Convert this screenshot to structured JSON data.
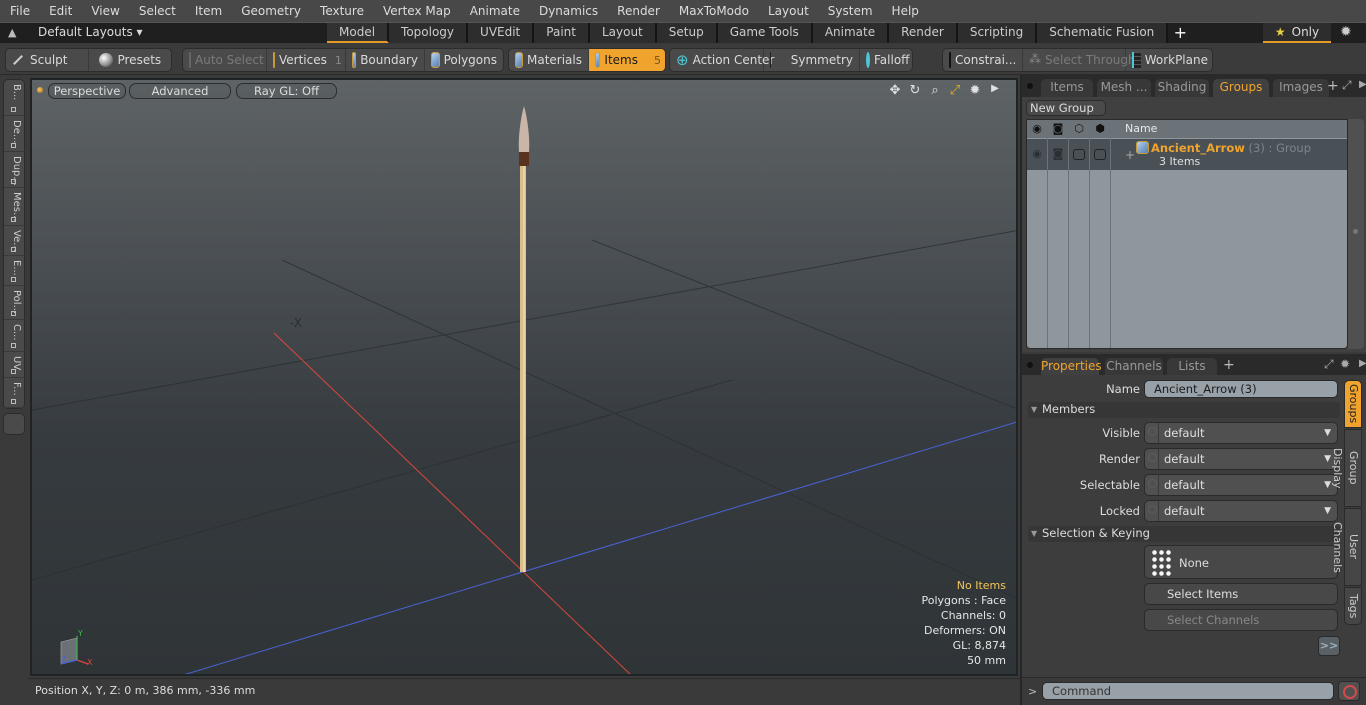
{
  "menubar": [
    "File",
    "Edit",
    "View",
    "Select",
    "Item",
    "Geometry",
    "Texture",
    "Vertex Map",
    "Animate",
    "Dynamics",
    "Render",
    "MaxToModo",
    "Layout",
    "System",
    "Help"
  ],
  "layoutbar": {
    "layouts_dropdown": "Default Layouts ▾",
    "tabs": [
      "Model",
      "Topology",
      "UVEdit",
      "Paint",
      "Layout",
      "Setup",
      "Game Tools",
      "Animate",
      "Render",
      "Scripting",
      "Schematic Fusion"
    ],
    "active_tab": "Model",
    "add_tab": "+",
    "only_label": "Only"
  },
  "toolbar": {
    "sculpt": "Sculpt",
    "presets": "Presets",
    "auto_select": "Auto Select",
    "vertices": "Vertices",
    "vertices_count": "1",
    "boundary": "Boundary",
    "polygons": "Polygons",
    "materials": "Materials",
    "items": "Items",
    "items_count": "5",
    "action_center": "Action Center",
    "symmetry": "Symmetry",
    "falloff": "Falloff",
    "constraints": "Constrai...",
    "select_through": "Select Through",
    "workplane": "WorkPlane"
  },
  "left_tabs": [
    "B...",
    "De...",
    "Dup...",
    "Mes...",
    "Ve...",
    "E...",
    "Pol...",
    "C...",
    "UV",
    "F..."
  ],
  "viewport": {
    "view_mode": "Perspective",
    "shading": "Advanced",
    "raygl": "Ray GL: Off",
    "stats": {
      "selection": "No Items",
      "polygons": "Polygons : Face",
      "channels": "Channels: 0",
      "deformers": "Deformers: ON",
      "gl": "GL: 8,874",
      "grid": "50 mm"
    },
    "axis_labels": {
      "x": "X",
      "y": "Y",
      "z": "Z"
    },
    "colors": {
      "x_axis": "#d9483a",
      "z_axis": "#4a63d8",
      "y_axis": "#3fb84a",
      "accent": "#f0a42d"
    }
  },
  "statusbar": {
    "position": "Position X, Y, Z:   0 m, 386 mm, -336 mm"
  },
  "groups_panel": {
    "tabs": [
      "Items",
      "Mesh ...",
      "Shading",
      "Groups",
      "Images"
    ],
    "active_tab": "Groups",
    "new_group": "New Group",
    "column_name": "Name",
    "rows": [
      {
        "name": "Ancient_Arrow",
        "count": "(3)",
        "type": ": Group",
        "sub": "3 Items"
      }
    ]
  },
  "properties_panel": {
    "tabs": [
      "Properties",
      "Channels",
      "Lists"
    ],
    "active_tab": "Properties",
    "name_label": "Name",
    "name_value": "Ancient_Arrow (3)",
    "members_section": "Members",
    "fields": [
      {
        "label": "Visible",
        "value": "default"
      },
      {
        "label": "Render",
        "value": "default"
      },
      {
        "label": "Selectable",
        "value": "default"
      },
      {
        "label": "Locked",
        "value": "default"
      }
    ],
    "selection_section": "Selection & Keying",
    "keying_value": "None",
    "select_items": "Select Items",
    "select_channels": "Select Channels",
    "more": ">>",
    "side_tabs": [
      "Groups",
      "Group Display",
      "User Channels",
      "Tags"
    ]
  },
  "command": {
    "prompt": ">",
    "placeholder": "Command"
  }
}
